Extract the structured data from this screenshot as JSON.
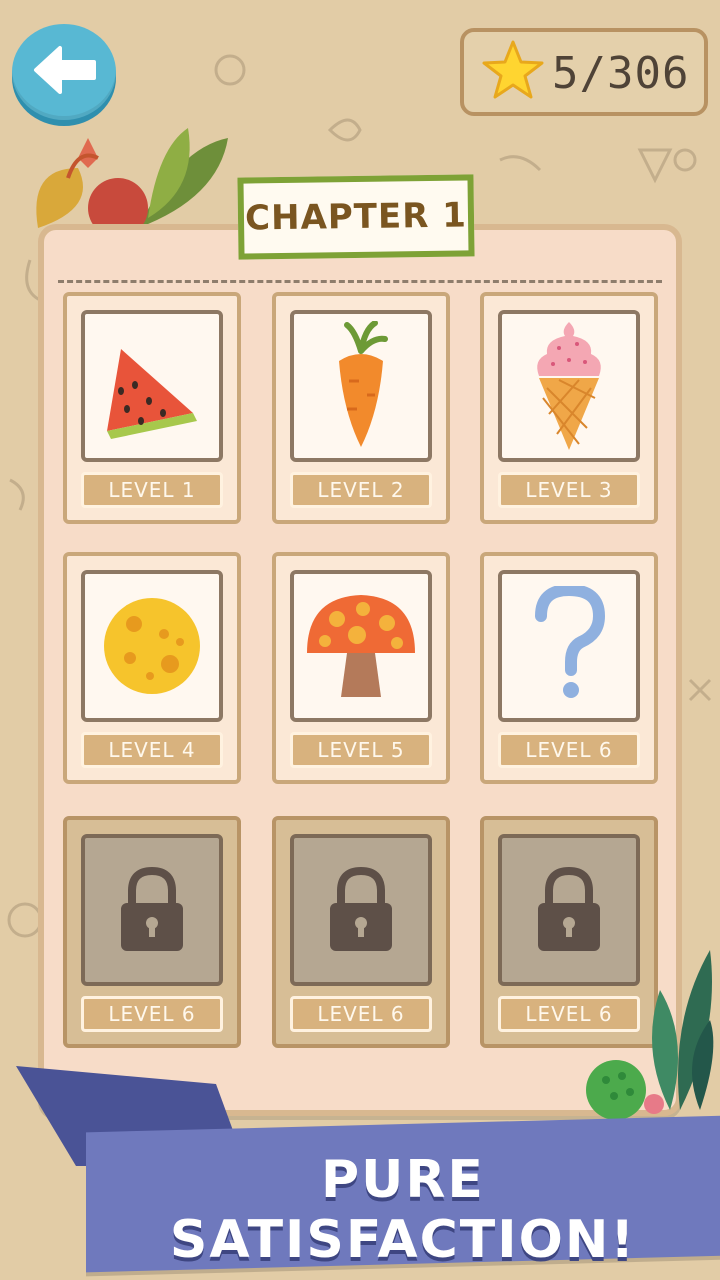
{
  "stars": {
    "count_text": "5/306",
    "icon": "star-icon"
  },
  "chapter": {
    "title": "CHAPTER 1"
  },
  "levels": [
    {
      "label": "LEVEL 1",
      "icon": "watermelon-icon",
      "locked": false
    },
    {
      "label": "LEVEL 2",
      "icon": "carrot-icon",
      "locked": false
    },
    {
      "label": "LEVEL 3",
      "icon": "ice-cream-icon",
      "locked": false
    },
    {
      "label": "LEVEL 4",
      "icon": "cheese-icon",
      "locked": false
    },
    {
      "label": "LEVEL 5",
      "icon": "mushroom-icon",
      "locked": false
    },
    {
      "label": "LEVEL 6",
      "icon": "question-mark-icon",
      "locked": false
    },
    {
      "label": "LEVEL 6",
      "icon": "lock-icon",
      "locked": true
    },
    {
      "label": "LEVEL 6",
      "icon": "lock-icon",
      "locked": true
    },
    {
      "label": "LEVEL 6",
      "icon": "lock-icon",
      "locked": true
    }
  ],
  "banner": {
    "text": "PURE SATISFACTION!"
  },
  "colors": {
    "background": "#e2cca6",
    "panel": "#f7dcc8",
    "accent_green": "#7ea236",
    "banner_blue": "#6f79bd",
    "back_button": "#58b8d3"
  }
}
